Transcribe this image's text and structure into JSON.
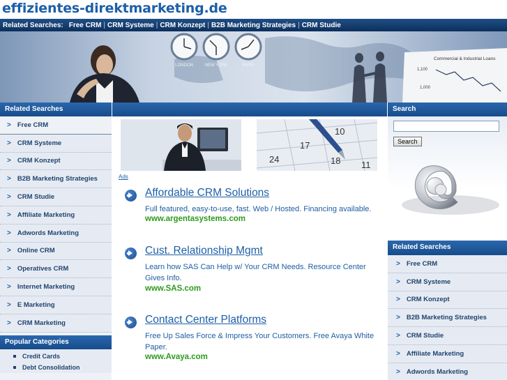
{
  "header": {
    "site_title": "effizientes-direktmarketing.de"
  },
  "top_bar": {
    "label": "Related Searches:",
    "links": [
      "Free CRM",
      "CRM Systeme",
      "CRM Konzept",
      "B2B Marketing Strategies",
      "CRM Studie"
    ]
  },
  "banner": {
    "clock_labels": [
      "LONDON",
      "NEW YORK",
      "PARIS"
    ],
    "chart_label": "Commercial & Industrial Loans",
    "chart_ticks": [
      "1,100",
      "1,000"
    ]
  },
  "left": {
    "related_header": "Related Searches",
    "related_items": [
      "Free CRM",
      "CRM Systeme",
      "CRM Konzept",
      "B2B Marketing Strategies",
      "CRM Studie",
      "Affiliate Marketing",
      "Adwords Marketing",
      "Online CRM",
      "Operatives CRM",
      "Internet Marketing",
      "E Marketing",
      "CRM Marketing"
    ],
    "popular_header": "Popular Categories",
    "popular_items": [
      "Credit Cards",
      "Debt Consolidation"
    ]
  },
  "center": {
    "ads_label": "Ads",
    "ads": [
      {
        "title": "Affordable CRM Solutions",
        "description": "Full featured, easy-to-use, fast. Web / Hosted. Financing available.",
        "url": "www.argentasystems.com"
      },
      {
        "title": "Cust. Relationship Mgmt",
        "description": "Learn how SAS Can Help w/ Your CRM Needs. Resource Center Gives Info.",
        "url": "www.SAS.com"
      },
      {
        "title": "Contact Center Platforms",
        "description": "Free Up Sales Force & Impress Your Customers. Free Avaya White Paper.",
        "url": "www.Avaya.com"
      }
    ],
    "calendar_numbers": [
      "17",
      "24",
      "18",
      "11",
      "10"
    ]
  },
  "right": {
    "search_header": "Search",
    "search_button": "Search",
    "search_placeholder": "",
    "related_header": "Related Searches",
    "related_items": [
      "Free CRM",
      "CRM Systeme",
      "CRM Konzept",
      "B2B Marketing Strategies",
      "CRM Studie",
      "Affiliate Marketing",
      "Adwords Marketing"
    ]
  },
  "colors": {
    "accent": "#1d5fa8",
    "header_bar": "#174c8b",
    "ad_url": "#2e9a1c"
  },
  "icons": {
    "nav_chevron": "chevron-right-icon",
    "ad_arrow": "arrow-right-icon",
    "search_art": "at-sign-icon"
  }
}
